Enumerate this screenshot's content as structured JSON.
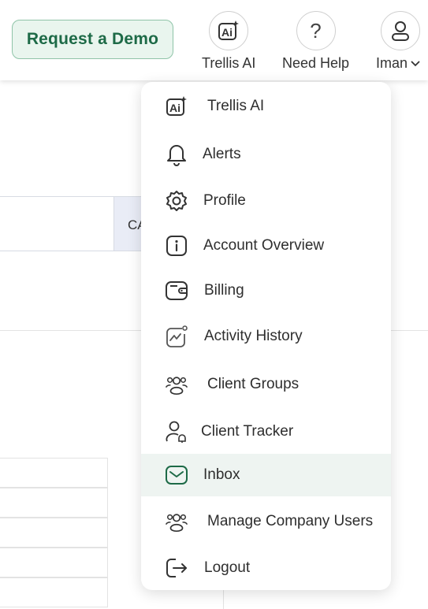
{
  "header": {
    "demo_button": "Request a Demo",
    "trellis_ai_label": "Trellis AI",
    "need_help_label": "Need Help",
    "help_glyph": "?",
    "user_label": "Iman",
    "ai_icon": "ai-sparkle-icon",
    "user_icon": "user-icon",
    "chevron_icon": "chevron-down-icon"
  },
  "background": {
    "cancel_partial": "CA"
  },
  "menu": {
    "items": [
      {
        "label": "Trellis AI",
        "icon": "ai-sparkle-icon"
      },
      {
        "label": "Alerts",
        "icon": "bell-icon"
      },
      {
        "label": "Profile",
        "icon": "gear-icon"
      },
      {
        "label": "Account Overview",
        "icon": "info-icon"
      },
      {
        "label": "Billing",
        "icon": "wallet-icon"
      },
      {
        "label": "Activity History",
        "icon": "activity-chart-icon"
      },
      {
        "label": "Client Groups",
        "icon": "group-icon"
      },
      {
        "label": "Client Tracker",
        "icon": "user-tracker-icon"
      },
      {
        "label": "Inbox",
        "icon": "mail-icon",
        "active": true
      },
      {
        "label": "Manage Company Users",
        "icon": "users-icon"
      },
      {
        "label": "Logout",
        "icon": "logout-icon"
      }
    ]
  },
  "colors": {
    "brand_green": "#1d6a47",
    "active_row": "#eef4f1"
  }
}
